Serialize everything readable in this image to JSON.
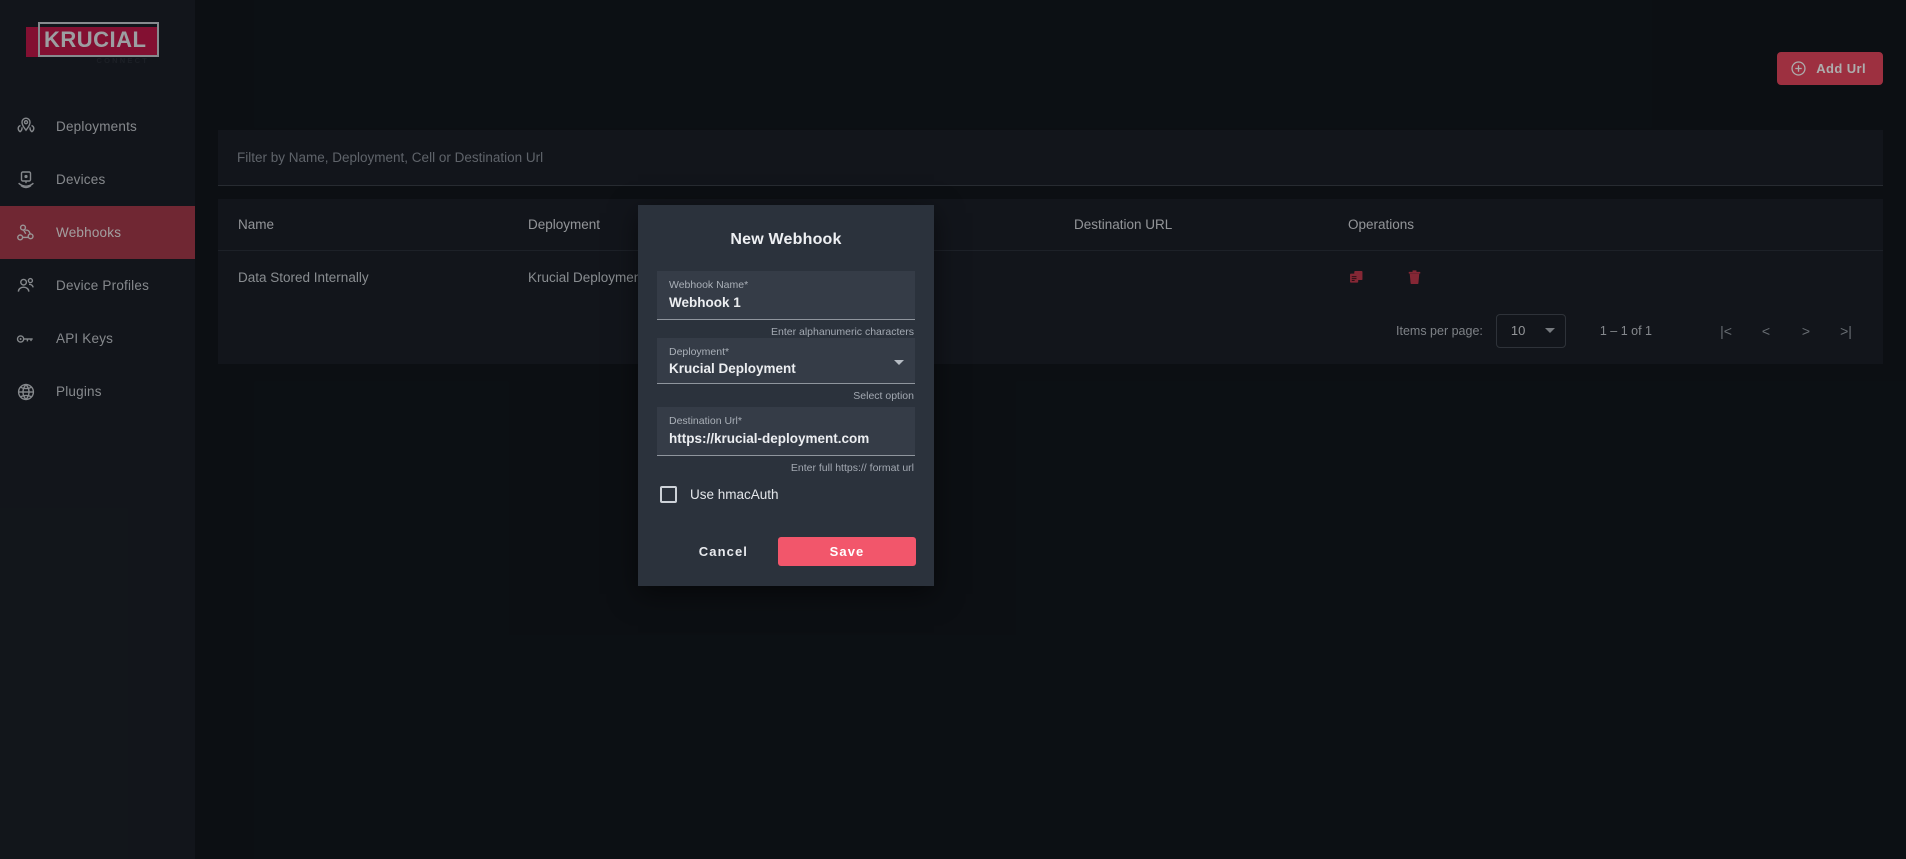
{
  "brand": {
    "name": "KRUCIAL",
    "tagline": "CONNECT",
    "accent": "#c2194b",
    "active_nav": "#a63a4c",
    "primary_button": "#e8475f",
    "save_button": "#f2566b"
  },
  "sidebar": {
    "items": [
      {
        "label": "Deployments",
        "icon": "map-pins-icon",
        "active": false
      },
      {
        "label": "Devices",
        "icon": "device-signal-icon",
        "active": false
      },
      {
        "label": "Webhooks",
        "icon": "webhook-icon",
        "active": true
      },
      {
        "label": "Device Profiles",
        "icon": "users-icon",
        "active": false
      },
      {
        "label": "API Keys",
        "icon": "key-icon",
        "active": false
      },
      {
        "label": "Plugins",
        "icon": "globe-icon",
        "active": false
      }
    ]
  },
  "toolbar": {
    "add_url_label": "Add Url",
    "add_icon": "plus-circle-icon"
  },
  "filter": {
    "placeholder": "Filter by Name, Deployment, Cell or Destination Url",
    "value": ""
  },
  "table": {
    "columns": [
      "Name",
      "Deployment",
      "Destination URL",
      "Operations"
    ],
    "rows": [
      {
        "name": "Data Stored Internally",
        "deployment": "Krucial Deployment",
        "destination_url": "",
        "operations": [
          "copy-icon",
          "delete-icon"
        ]
      }
    ]
  },
  "paginator": {
    "items_per_page_label": "Items per page:",
    "items_per_page_value": "10",
    "range_label": "1 – 1 of 1",
    "first_page": "|<",
    "prev_page": "<",
    "next_page": ">",
    "last_page": ">|"
  },
  "modal": {
    "title": "New Webhook",
    "fields": {
      "webhook_name": {
        "label": "Webhook Name*",
        "value": "Webhook 1",
        "hint": "Enter alphanumeric characters"
      },
      "deployment": {
        "label": "Deployment*",
        "value": "Krucial Deployment",
        "hint": "Select option"
      },
      "destination_url": {
        "label": "Destination Url*",
        "value": "https://krucial-deployment.com",
        "hint": "Enter full https:// format url"
      }
    },
    "hmac_checkbox_label": "Use hmacAuth",
    "hmac_checked": false,
    "cancel_label": "Cancel",
    "save_label": "Save"
  }
}
